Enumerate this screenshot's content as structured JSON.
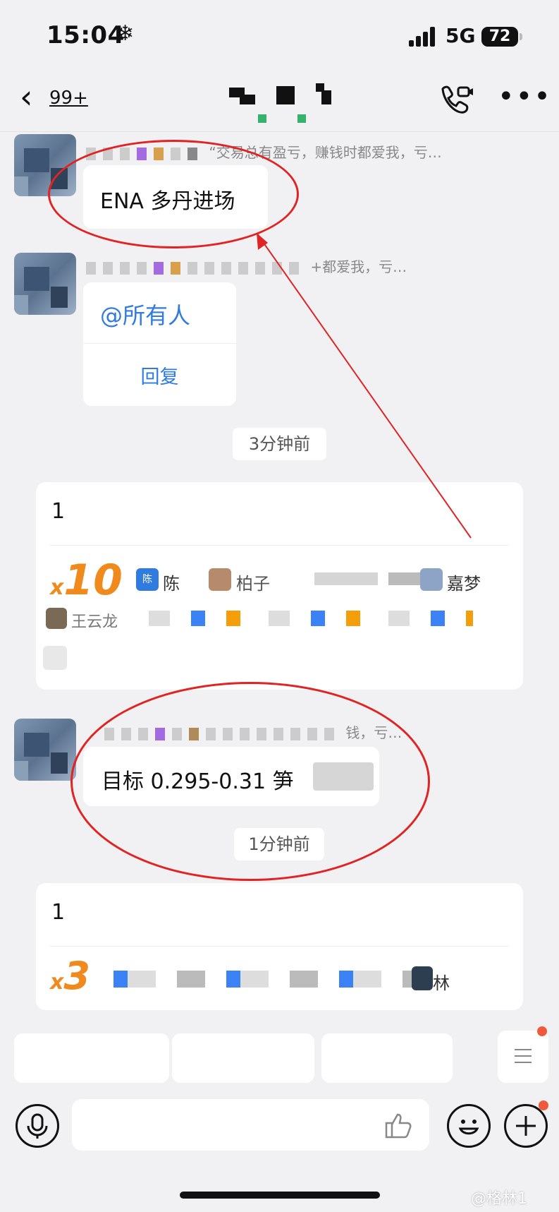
{
  "status_bar": {
    "time": "15:04",
    "weather_symbol": "❄",
    "network": "5G",
    "battery": "72"
  },
  "nav": {
    "back_badge": "99+"
  },
  "messages": [
    {
      "sender_suffix": "“交易总有盈亏，赚钱时都爱我，亏…",
      "text": "ENA 多丹进场"
    },
    {
      "sender_suffix": "+都爱我，亏…",
      "mention": "@所有人",
      "reply_label": "回复"
    }
  ],
  "time_chips": [
    "3分钟前",
    "1分钟前"
  ],
  "reaction_cards": [
    {
      "text": "1",
      "count_prefix": "x",
      "count": "10",
      "names": [
        "陈",
        "柏子",
        "嘉梦",
        "王云龙"
      ],
      "tag": "陈"
    },
    {
      "text": "1",
      "count_prefix": "x",
      "count": "3",
      "names": [
        "林"
      ]
    }
  ],
  "target_message": {
    "sender_suffix": "钱，亏…",
    "text": "目标 0.295-0.31 笋"
  },
  "watermark": "@格林1",
  "colors": {
    "accent_orange": "#f08a1c",
    "link_blue": "#2f7be0",
    "annotation_red": "#e02424"
  },
  "icons": [
    "snowflake-icon",
    "signal-icon",
    "battery-icon",
    "back-icon",
    "video-call-icon",
    "more-icon",
    "microphone-icon",
    "thumbs-up-icon",
    "emoji-icon",
    "plus-icon",
    "menu-icon"
  ]
}
